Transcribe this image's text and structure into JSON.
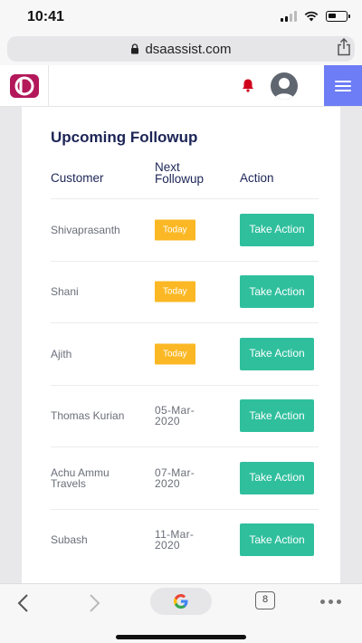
{
  "status_bar": {
    "time": "10:41",
    "icons": [
      "signal-icon",
      "wifi-icon",
      "battery-icon"
    ]
  },
  "browser": {
    "url": "dsaassist.com",
    "icons": [
      "lock-icon",
      "share-icon"
    ],
    "tab_count": "8"
  },
  "app_header": {
    "icons": [
      "logo",
      "bell-icon",
      "avatar",
      "menu-icon"
    ],
    "accent_color": "#6d7df5",
    "bell_color": "#d0021b"
  },
  "followup": {
    "title": "Upcoming Followup",
    "columns": {
      "customer": "Customer",
      "next_followup": "Next Followup",
      "action": "Action"
    },
    "rows": [
      {
        "customer": "Shivaprasanth",
        "next_followup": "Today",
        "is_today": true,
        "action": "Take Action"
      },
      {
        "customer": "Shani",
        "next_followup": "Today",
        "is_today": true,
        "action": "Take Action"
      },
      {
        "customer": "Ajith",
        "next_followup": "Today",
        "is_today": true,
        "action": "Take Action"
      },
      {
        "customer": "Thomas Kurian",
        "next_followup": "05-Mar-2020",
        "is_today": false,
        "action": "Take Action"
      },
      {
        "customer": "Achu Ammu Travels",
        "next_followup": "07-Mar-2020",
        "is_today": false,
        "action": "Take Action"
      },
      {
        "customer": "Subash",
        "next_followup": "11-Mar-2020",
        "is_today": false,
        "action": "Take Action"
      }
    ],
    "colors": {
      "today_badge": "#fbb824",
      "action_button": "#2fbf9d",
      "title": "#1c2556"
    }
  }
}
